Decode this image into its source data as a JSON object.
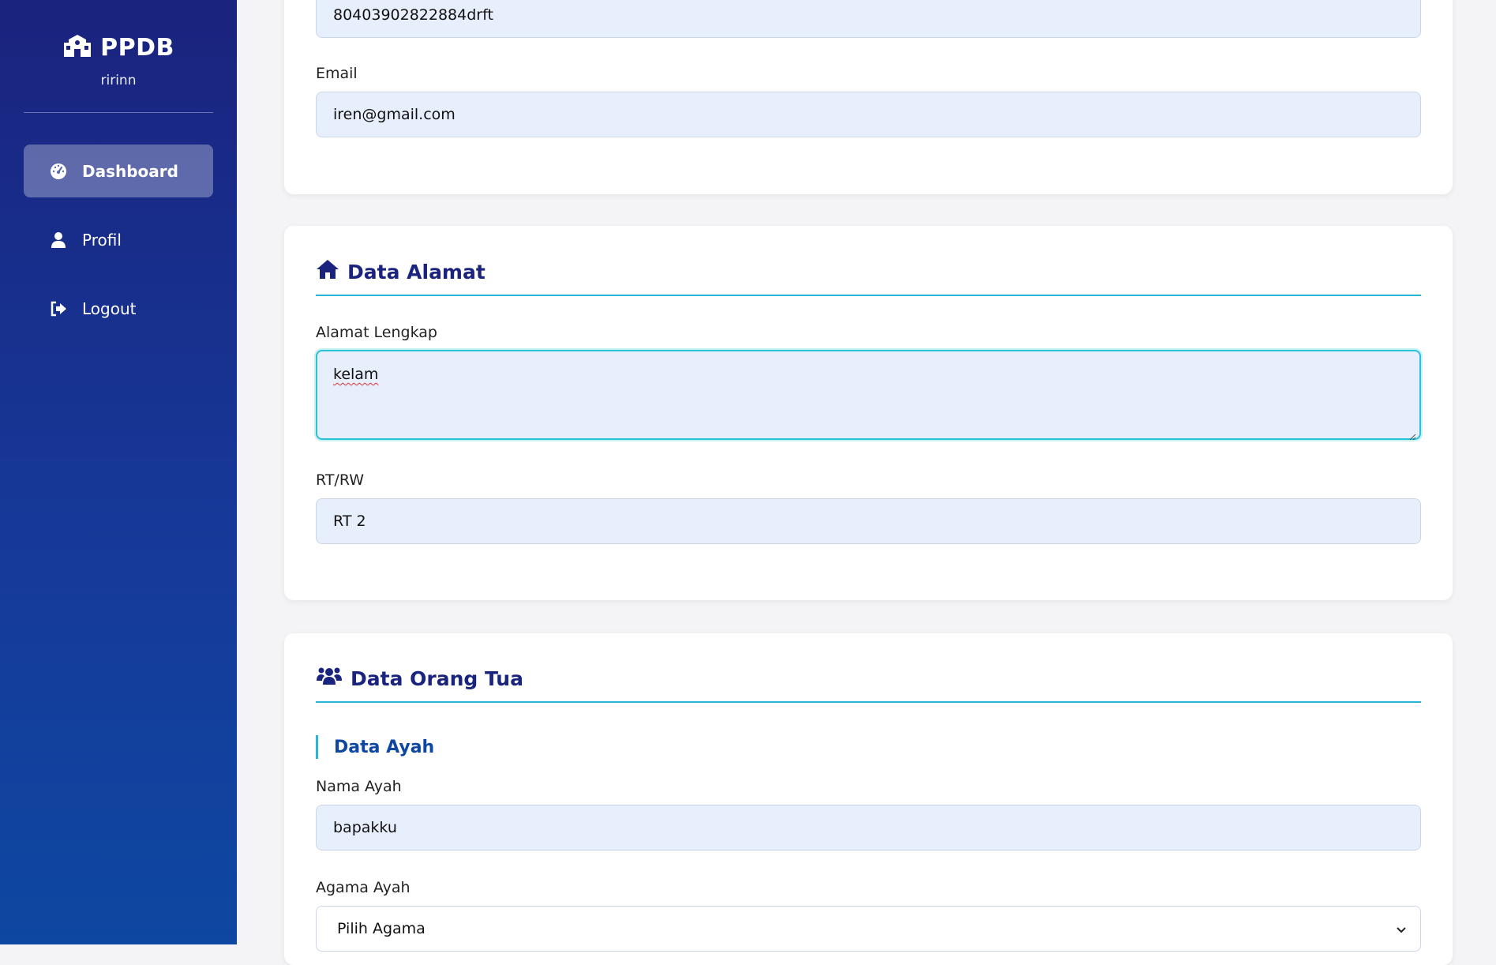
{
  "sidebar": {
    "brand": "PPDB",
    "brand_icon": "school-icon",
    "username": "ririnn",
    "items": [
      {
        "label": "Dashboard",
        "icon": "tachometer-icon",
        "active": true
      },
      {
        "label": "Profil",
        "icon": "user-icon",
        "active": false
      },
      {
        "label": "Logout",
        "icon": "sign-out-icon",
        "active": false
      }
    ]
  },
  "form": {
    "top_field_value": "80403902822884drft",
    "email": {
      "label": "Email",
      "value": "iren@gmail.com"
    },
    "alamat": {
      "title": "Data Alamat",
      "icon": "home-icon",
      "alamat_label": "Alamat Lengkap",
      "alamat_value": "kelam",
      "rtrw_label": "RT/RW",
      "rtrw_value": "RT 2"
    },
    "orang_tua": {
      "title": "Data Orang Tua",
      "icon": "users-icon",
      "ayah_title": "Data Ayah",
      "nama_ayah_label": "Nama Ayah",
      "nama_ayah_value": "bapakku",
      "agama_ayah_label": "Agama Ayah",
      "agama_ayah_selected": "Pilih Agama"
    }
  },
  "colors": {
    "accent": "#1a237e",
    "line": "#29b6d6",
    "input_bg": "#e8effc"
  }
}
